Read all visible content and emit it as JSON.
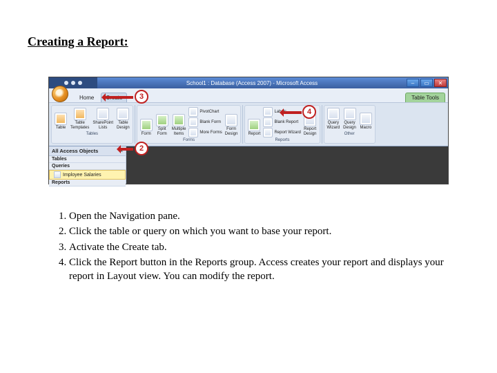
{
  "title": "Creating a Report:",
  "window": {
    "title": "School1 : Database (Access 2007) - Microsoft Access"
  },
  "tabs": {
    "home": "Home",
    "create": "Create",
    "context": "Table Tools"
  },
  "ribbon": {
    "tables": {
      "caption": "Tables",
      "table": "Table",
      "templates": "Table\nTemplates",
      "sharepoint": "SharePoint\nLists",
      "design": "Table\nDesign"
    },
    "forms": {
      "caption": "Forms",
      "form": "Form",
      "split": "Split\nForm",
      "multiple": "Multiple\nItems",
      "pivot": "PivotChart",
      "blank": "Blank Form",
      "more": "More Forms",
      "design": "Form\nDesign"
    },
    "reports": {
      "caption": "Reports",
      "report": "Report",
      "labels": "Labels",
      "blank": "Blank Report",
      "wizard": "Report Wizard",
      "design": "Report\nDesign"
    },
    "other": {
      "caption": "Other",
      "queryw": "Query\nWizard",
      "queryd": "Query\nDesign",
      "macro": "Macro"
    }
  },
  "nav": {
    "header": "All Access Objects",
    "tables_cat": "Tables",
    "queries_cat": "Queries",
    "reports_cat": "Reports",
    "selected_item": "Imployee Salaries"
  },
  "callouts": {
    "c2": "2",
    "c3": "3",
    "c4": "4"
  },
  "steps": [
    "Open the Navigation pane.",
    "Click the table or query on which you want to base your report.",
    "Activate the Create tab.",
    "Click the Report button in the Reports group. Access creates your report and displays your report in Layout view. You can modify the report."
  ]
}
